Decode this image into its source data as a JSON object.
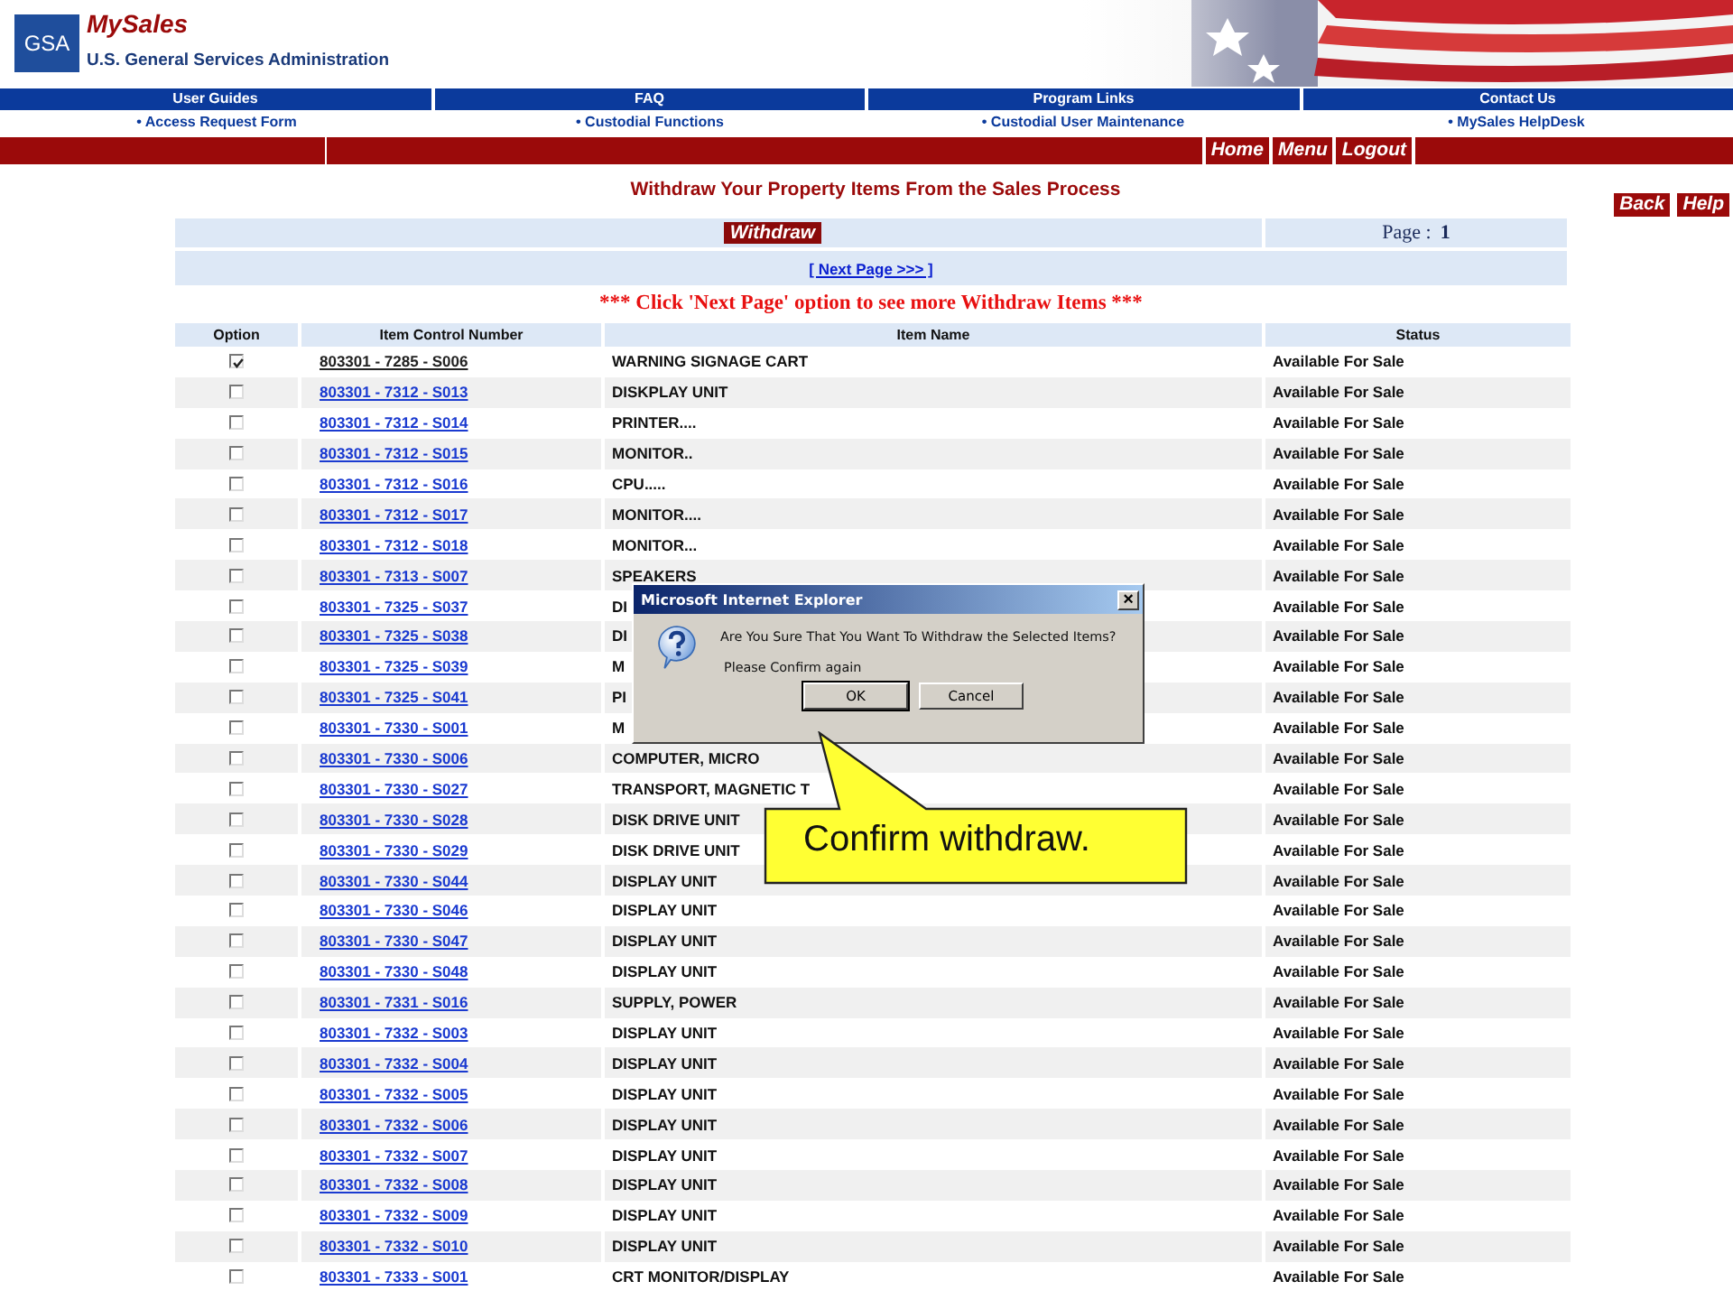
{
  "header": {
    "logo": "GSA",
    "brand": "MySales",
    "agency": "U.S. General Services Administration"
  },
  "nav": [
    "User Guides",
    "FAQ",
    "Program Links",
    "Contact Us"
  ],
  "sublinks": [
    "• Access Request Form",
    "• Custodial Functions",
    "• Custodial User Maintenance",
    "• MySales HelpDesk"
  ],
  "top_buttons": [
    "Home",
    "Menu",
    "Logout"
  ],
  "page_title": "Withdraw Your Property Items From the Sales Process",
  "side_buttons": [
    "Back",
    "Help"
  ],
  "withdraw_button": "Withdraw",
  "page_label": "Page :",
  "page_number": "1",
  "next_page": "[ Next Page >>> ]",
  "notice": "*** Click 'Next Page' option to see more Withdraw Items ***",
  "table": {
    "columns": [
      "Option",
      "Item Control Number",
      "Item Name",
      "Status"
    ],
    "rows": [
      {
        "checked": true,
        "visited": true,
        "number": "803301 - 7285 - S006",
        "name": "WARNING SIGNAGE CART",
        "status": "Available For Sale"
      },
      {
        "checked": false,
        "visited": false,
        "number": "803301 - 7312 - S013",
        "name": "DISKPLAY UNIT",
        "status": "Available For Sale"
      },
      {
        "checked": false,
        "visited": false,
        "number": "803301 - 7312 - S014",
        "name": "PRINTER....",
        "status": "Available For Sale"
      },
      {
        "checked": false,
        "visited": false,
        "number": "803301 - 7312 - S015",
        "name": "MONITOR..",
        "status": "Available For Sale"
      },
      {
        "checked": false,
        "visited": false,
        "number": "803301 - 7312 - S016",
        "name": "CPU.....",
        "status": "Available For Sale"
      },
      {
        "checked": false,
        "visited": false,
        "number": "803301 - 7312 - S017",
        "name": "MONITOR....",
        "status": "Available For Sale"
      },
      {
        "checked": false,
        "visited": false,
        "number": "803301 - 7312 - S018",
        "name": "MONITOR...",
        "status": "Available For Sale"
      },
      {
        "checked": false,
        "visited": false,
        "number": "803301 - 7313 - S007",
        "name": "SPEAKERS",
        "status": "Available For Sale"
      },
      {
        "checked": false,
        "visited": false,
        "number": "803301 - 7325 - S037",
        "name": "DI",
        "status": "Available For Sale"
      },
      {
        "checked": false,
        "visited": false,
        "number": "803301 - 7325 - S038",
        "name": "DI",
        "status": "Available For Sale"
      },
      {
        "checked": false,
        "visited": false,
        "number": "803301 - 7325 - S039",
        "name": "M",
        "status": "Available For Sale"
      },
      {
        "checked": false,
        "visited": false,
        "number": "803301 - 7325 - S041",
        "name": "PI",
        "status": "Available For Sale"
      },
      {
        "checked": false,
        "visited": false,
        "number": "803301 - 7330 - S001",
        "name": "M",
        "status": "Available For Sale"
      },
      {
        "checked": false,
        "visited": false,
        "number": "803301 - 7330 - S006",
        "name": "COMPUTER, MICRO",
        "status": "Available For Sale"
      },
      {
        "checked": false,
        "visited": false,
        "number": "803301 - 7330 - S027",
        "name": "TRANSPORT, MAGNETIC T",
        "status": "Available For Sale"
      },
      {
        "checked": false,
        "visited": false,
        "number": "803301 - 7330 - S028",
        "name": "DISK DRIVE UNIT",
        "status": "Available For Sale"
      },
      {
        "checked": false,
        "visited": false,
        "number": "803301 - 7330 - S029",
        "name": "DISK DRIVE UNIT",
        "status": "Available For Sale"
      },
      {
        "checked": false,
        "visited": false,
        "number": "803301 - 7330 - S044",
        "name": "DISPLAY UNIT",
        "status": "Available For Sale"
      },
      {
        "checked": false,
        "visited": false,
        "number": "803301 - 7330 - S046",
        "name": "DISPLAY UNIT",
        "status": "Available For Sale"
      },
      {
        "checked": false,
        "visited": false,
        "number": "803301 - 7330 - S047",
        "name": "DISPLAY UNIT",
        "status": "Available For Sale"
      },
      {
        "checked": false,
        "visited": false,
        "number": "803301 - 7330 - S048",
        "name": "DISPLAY UNIT",
        "status": "Available For Sale"
      },
      {
        "checked": false,
        "visited": false,
        "number": "803301 - 7331 - S016",
        "name": "SUPPLY, POWER",
        "status": "Available For Sale"
      },
      {
        "checked": false,
        "visited": false,
        "number": "803301 - 7332 - S003",
        "name": "DISPLAY UNIT",
        "status": "Available For Sale"
      },
      {
        "checked": false,
        "visited": false,
        "number": "803301 - 7332 - S004",
        "name": "DISPLAY UNIT",
        "status": "Available For Sale"
      },
      {
        "checked": false,
        "visited": false,
        "number": "803301 - 7332 - S005",
        "name": "DISPLAY UNIT",
        "status": "Available For Sale"
      },
      {
        "checked": false,
        "visited": false,
        "number": "803301 - 7332 - S006",
        "name": "DISPLAY UNIT",
        "status": "Available For Sale"
      },
      {
        "checked": false,
        "visited": false,
        "number": "803301 - 7332 - S007",
        "name": "DISPLAY UNIT",
        "status": "Available For Sale"
      },
      {
        "checked": false,
        "visited": false,
        "number": "803301 - 7332 - S008",
        "name": "DISPLAY UNIT",
        "status": "Available For Sale"
      },
      {
        "checked": false,
        "visited": false,
        "number": "803301 - 7332 - S009",
        "name": "DISPLAY UNIT",
        "status": "Available For Sale"
      },
      {
        "checked": false,
        "visited": false,
        "number": "803301 - 7332 - S010",
        "name": "DISPLAY UNIT",
        "status": "Available For Sale"
      },
      {
        "checked": false,
        "visited": false,
        "number": "803301 - 7333 - S001",
        "name": "CRT MONITOR/DISPLAY",
        "status": "Available For Sale"
      }
    ]
  },
  "dialog": {
    "title": "Microsoft Internet Explorer",
    "close": "×",
    "message": "Are You Sure That You Want To Withdraw the Selected Items?",
    "sub_message": "Please Confirm again",
    "buttons": [
      "OK",
      "Cancel"
    ]
  },
  "callout": {
    "text": "Confirm withdraw."
  }
}
